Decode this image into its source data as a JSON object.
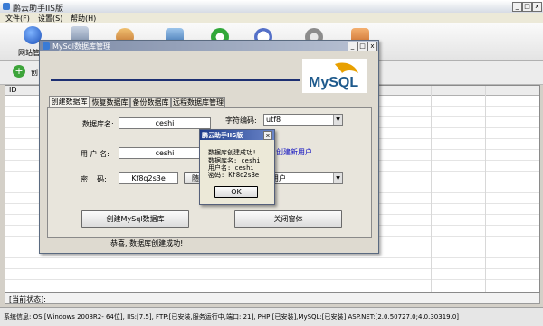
{
  "app": {
    "title": "鹏云助手IIS版"
  },
  "menu": {
    "items": [
      "文件(F)",
      "设置(S)",
      "帮助(H)"
    ]
  },
  "toolbar": {
    "website_label": "网站管"
  },
  "sub_toolbar": {
    "add_label": "创"
  },
  "grid": {
    "id_header": "ID"
  },
  "status": {
    "current_label": "[当前状态]:",
    "system_info": "系统信息: OS:[Windows 2008R2- 64位], IIS:[7.5], FTP:[已安装,服务运行中,端口: 21], PHP:[已安装],MySQL:[已安装] ASP.NET:[2.0.50727.0;4.0.30319.0]"
  },
  "dialog": {
    "title": "MySql数据库管理",
    "logo_text": "MySQL",
    "tabs": [
      "创建数据库",
      "恢复数据库",
      "备份数据库",
      "远程数据库管理"
    ],
    "db_name_label": "数据库名:",
    "db_name_value": "ceshi",
    "charset_label": "字符编码:",
    "charset_value": "utf8",
    "user_label": "用 户 名:",
    "user_value": "ceshi",
    "create_user_link": "创建新用户",
    "password_label": "密    码:",
    "password_value": "Kf8q2s3e",
    "random_btn": "随",
    "user_type_value": "用户",
    "create_button": "创建MySql数据库",
    "close_button": "关闭窗体",
    "success_text": "恭喜, 数据库创建成功!"
  },
  "message": {
    "title": "鹏云助手IIS版",
    "lines": [
      "数据库创建成功!",
      "数据库名: ceshi",
      "用户名: ceshi",
      "密码: Kf8q2s3e"
    ],
    "ok": "OK"
  }
}
